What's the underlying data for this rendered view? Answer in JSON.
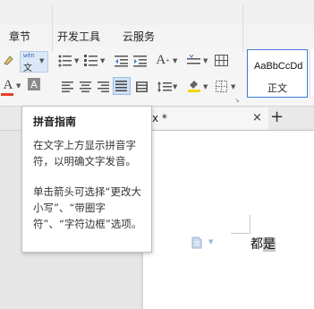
{
  "menu": {
    "items": [
      "章节",
      "开发工具",
      "云服务"
    ]
  },
  "ribbon": {
    "pinyin": {
      "top": "wén",
      "bottom": "文"
    },
    "font_color_letter": "A",
    "char_border_letter": "A",
    "styles": {
      "sample": "AaBbCcDd",
      "label": "正文"
    }
  },
  "tabs": {
    "doc_title": "x *",
    "close": "×",
    "new": "+"
  },
  "tooltip": {
    "title": "拼音指南",
    "para1": "在文字上方显示拼音字符，以明确文字发音。",
    "para2": "单击箭头可选择“更改大小写”、“带圈字符”、“字符边框”选项。"
  },
  "document": {
    "text_plain": "都",
    "text_selected": "是"
  },
  "colors": {
    "accent": "#3b7bd6",
    "font_color_bar": "#e3402a",
    "highlight": "#f2d600"
  }
}
